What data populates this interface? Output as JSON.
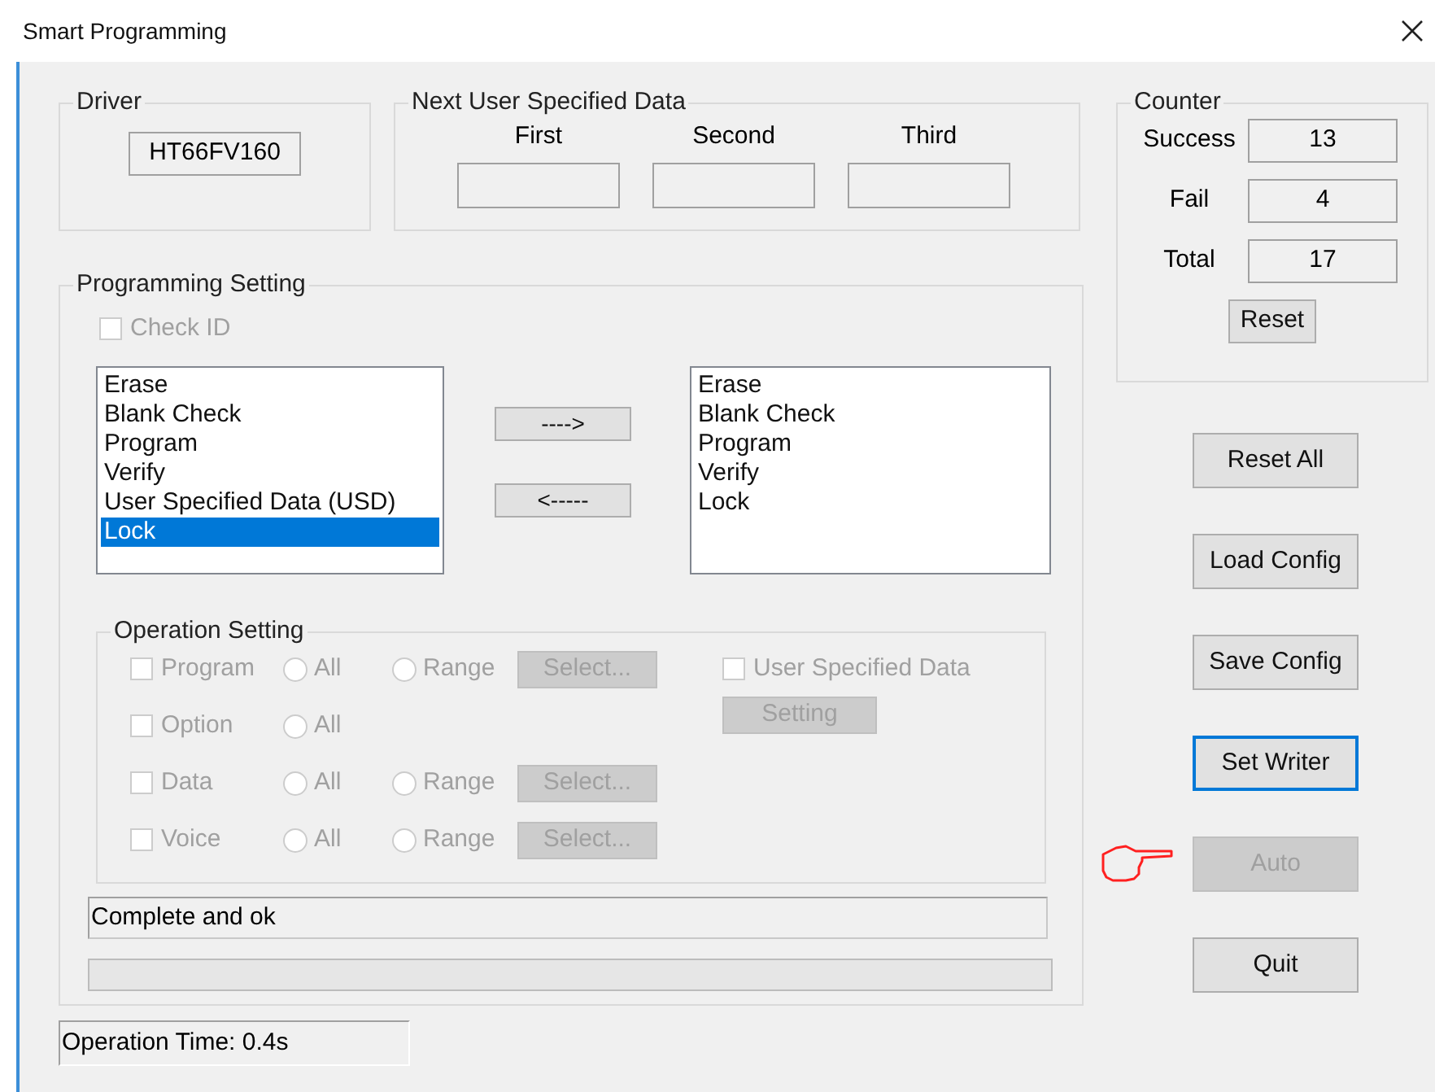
{
  "window": {
    "title": "Smart Programming"
  },
  "driver": {
    "label": "Driver",
    "value": "HT66FV160"
  },
  "next_user_data": {
    "label": "Next User Specified Data",
    "fields": [
      {
        "label": "First"
      },
      {
        "label": "Second"
      },
      {
        "label": "Third"
      }
    ]
  },
  "counter": {
    "label": "Counter",
    "rows": [
      {
        "label": "Success",
        "value": "13"
      },
      {
        "label": "Fail",
        "value": "4"
      },
      {
        "label": "Total",
        "value": "17"
      }
    ],
    "reset_button": "Reset"
  },
  "programming_setting": {
    "label": "Programming Setting",
    "check_id": {
      "label": "Check ID",
      "checked": false,
      "disabled": true
    },
    "available_items": [
      {
        "label": "Erase",
        "selected": false
      },
      {
        "label": "Blank Check",
        "selected": false
      },
      {
        "label": "Program",
        "selected": false
      },
      {
        "label": "Verify",
        "selected": false
      },
      {
        "label": "User Specified Data (USD)",
        "selected": false
      },
      {
        "label": "Lock",
        "selected": true
      }
    ],
    "add_button": "---->",
    "remove_button": "<-----",
    "selected_items": [
      {
        "label": "Erase",
        "selected": false
      },
      {
        "label": "Blank Check",
        "selected": false
      },
      {
        "label": "Program",
        "selected": false
      },
      {
        "label": "Verify",
        "selected": false
      },
      {
        "label": "Lock",
        "selected": false
      }
    ],
    "operation_setting": {
      "label": "Operation Setting",
      "disabled": true,
      "rows": [
        {
          "label": "Program",
          "checked": false,
          "all": {
            "label": "All",
            "selected": false
          },
          "range": {
            "label": "Range",
            "selected": false
          },
          "select_button": "Select..."
        },
        {
          "label": "Option",
          "checked": false,
          "all": {
            "label": "All",
            "selected": false
          }
        },
        {
          "label": "Data",
          "checked": false,
          "all": {
            "label": "All",
            "selected": false
          },
          "range": {
            "label": "Range",
            "selected": false
          },
          "select_button": "Select..."
        },
        {
          "label": "Voice",
          "checked": false,
          "all": {
            "label": "All",
            "selected": false
          },
          "range": {
            "label": "Range",
            "selected": false
          },
          "select_button": "Select..."
        }
      ],
      "usd": {
        "label": "User Specified Data",
        "checked": false
      },
      "setting_button": "Setting"
    },
    "status": "Complete and ok",
    "progress": {
      "level": 0
    }
  },
  "buttons": [
    {
      "label": "Reset All",
      "disabled": false,
      "focused": false,
      "pointer": false
    },
    {
      "label": "Load Config",
      "disabled": false,
      "focused": false,
      "pointer": false
    },
    {
      "label": "Save Config",
      "disabled": false,
      "focused": false,
      "pointer": false
    },
    {
      "label": "Set Writer",
      "disabled": false,
      "focused": true,
      "pointer": false
    },
    {
      "label": "Auto",
      "disabled": true,
      "focused": false,
      "pointer": true
    },
    {
      "label": "Quit",
      "disabled": false,
      "focused": false,
      "pointer": false
    }
  ],
  "operation_time": "Operation Time: 0.4s"
}
